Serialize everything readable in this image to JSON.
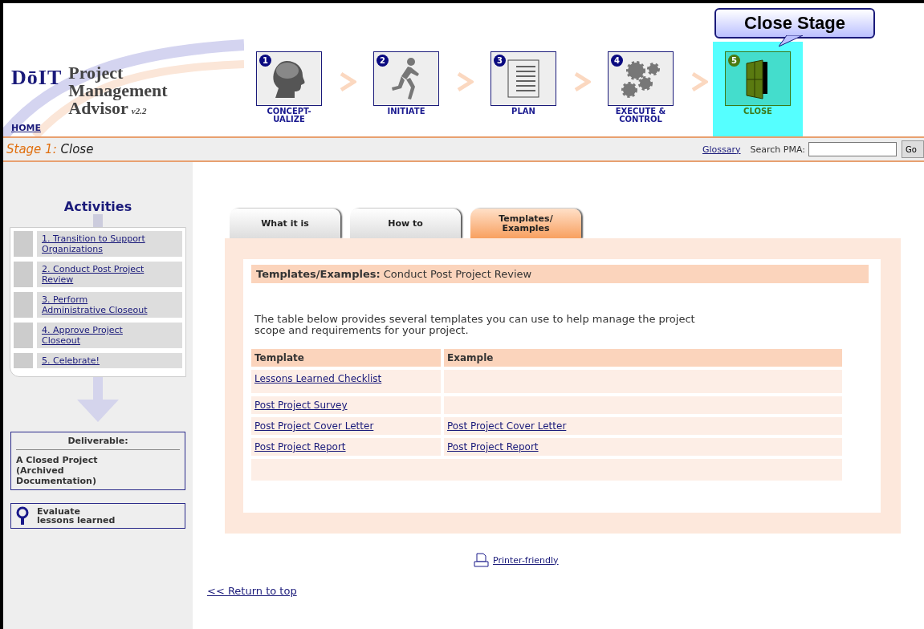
{
  "logo": {
    "mark": "DōIT",
    "title_lines": [
      "Project",
      "Management",
      "Advisor"
    ],
    "version": "v2.2",
    "home_link": "HOME"
  },
  "callout": "Close Stage",
  "stages": [
    {
      "number": "1",
      "label": "CONCEPT-\nUALIZE",
      "kind": "head",
      "selected": false
    },
    {
      "number": "2",
      "label": "INITIATE",
      "kind": "runner",
      "selected": false
    },
    {
      "number": "3",
      "label": "PLAN",
      "kind": "checklist",
      "selected": false
    },
    {
      "number": "4",
      "label": "EXECUTE &\nCONTROL",
      "kind": "gears",
      "selected": false
    },
    {
      "number": "5",
      "label": "CLOSE",
      "kind": "door",
      "selected": true
    }
  ],
  "stage_bar": {
    "prefix": "Stage 1:",
    "name": "Close",
    "glossary": "Glossary",
    "search_label": "Search PMA:",
    "go": "Go"
  },
  "sidebar": {
    "title": "Activities",
    "activities": [
      "1. Transition to Support Organizations",
      "2. Conduct Post Project Review",
      "3. Perform Administrative Closeout",
      "4. Approve Project Closeout",
      "5. Celebrate!"
    ],
    "deliverable_title": "Deliverable:",
    "deliverable": "A Closed Project (Archived Documentation)",
    "evaluate": "Evaluate lessons learned"
  },
  "tabs": [
    {
      "label": "What it is",
      "selected": false
    },
    {
      "label": "How to",
      "selected": false
    },
    {
      "label": "Templates/\nExamples",
      "selected": true
    }
  ],
  "panel": {
    "heading": "**Templates/Examples:** Conduct Post Project Review",
    "intro": "The table below provides several templates you can use to help manage the project scope and requirements for your project.",
    "table": {
      "columns": [
        "Template",
        "Example"
      ],
      "rows": [
        [
          "Lessons Learned Checklist",
          null
        ],
        [
          "Post Project Survey",
          null
        ],
        [
          "Post Project Cover Letter",
          "Post Project Cover Letter"
        ],
        [
          "Post Project Report",
          "Post Project Report"
        ]
      ]
    }
  },
  "printer_link": "Printer-friendly",
  "return_link": "<< Return to top"
}
